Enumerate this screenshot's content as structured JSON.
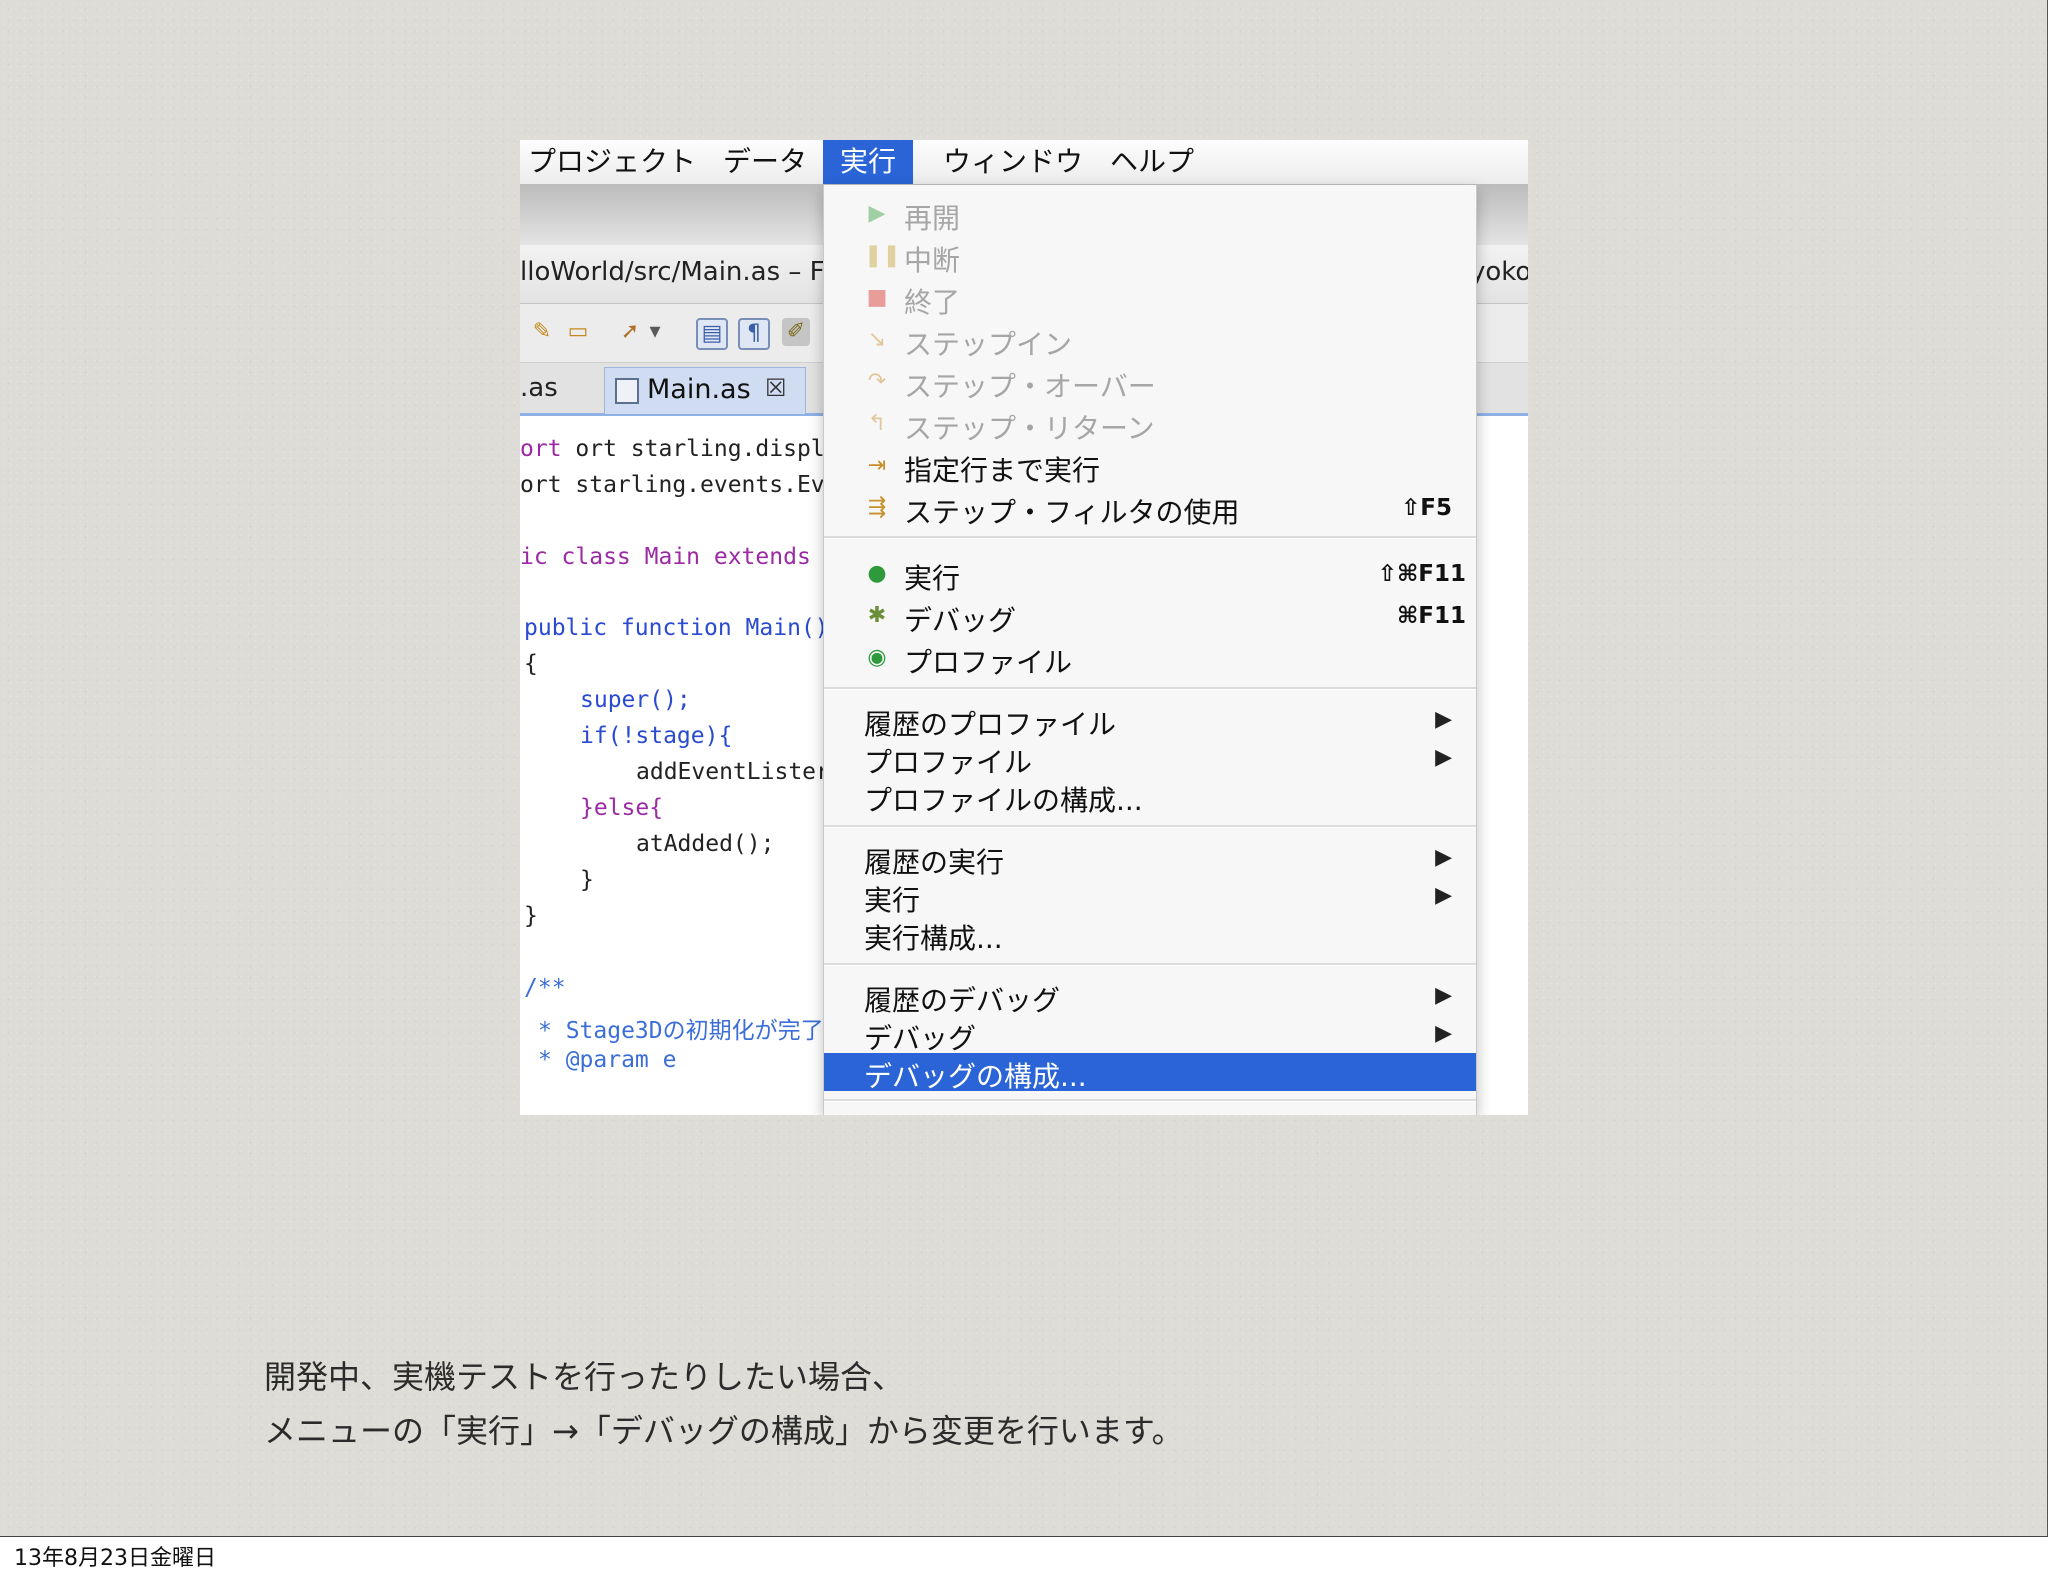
{
  "screenshot": {
    "menubar": [
      "プロジェクト",
      "データ",
      "実行",
      "ウィンドウ",
      "ヘルプ"
    ],
    "active_menu": "実行",
    "title_left": "lloWorld/src/Main.as – F",
    "title_right": "yoko",
    "tabs": {
      "left": ".as",
      "active": "Main.as",
      "close": "☒"
    },
    "code_lines": [
      "ort starling.display.Sp",
      "ort starling.events.Eve",
      "ic class Main extends",
      "public function Main()",
      "{",
      "super();",
      "if(!stage){",
      "addEventLister",
      "}else{",
      "atAdded();",
      "}",
      "}",
      "/**",
      "* Stage3Dの初期化が完了",
      "* @param e"
    ],
    "dropdown": {
      "debug_group": [
        {
          "label": "再開",
          "icon": "resume-icon",
          "disabled": true
        },
        {
          "label": "中断",
          "icon": "suspend-icon",
          "disabled": true
        },
        {
          "label": "終了",
          "icon": "terminate-icon",
          "disabled": true
        },
        {
          "label": "ステップイン",
          "icon": "step-into-icon",
          "disabled": true
        },
        {
          "label": "ステップ・オーバー",
          "icon": "step-over-icon",
          "disabled": true
        },
        {
          "label": "ステップ・リターン",
          "icon": "step-return-icon",
          "disabled": true
        },
        {
          "label": "指定行まで実行",
          "icon": "run-to-line-icon",
          "disabled": false
        },
        {
          "label": "ステップ・フィルタの使用",
          "icon": "step-filter-icon",
          "shortcut": "⇧F5",
          "disabled": false
        }
      ],
      "launch_group": [
        {
          "label": "実行",
          "icon": "run-icon",
          "shortcut": "⇧⌘F11"
        },
        {
          "label": "デバッグ",
          "icon": "debug-icon",
          "shortcut": "⌘F11"
        },
        {
          "label": "プロファイル",
          "icon": "profile-icon",
          "shortcut": ""
        }
      ],
      "profile_group": [
        {
          "label": "履歴のプロファイル",
          "submenu": true
        },
        {
          "label": "プロファイル",
          "submenu": true
        },
        {
          "label": "プロファイルの構成...",
          "submenu": false
        }
      ],
      "run_group": [
        {
          "label": "履歴の実行",
          "submenu": true
        },
        {
          "label": "実行",
          "submenu": true
        },
        {
          "label": "実行構成...",
          "submenu": false
        }
      ],
      "debug_config_group": [
        {
          "label": "履歴のデバッグ",
          "submenu": true
        },
        {
          "label": "デバッグ",
          "submenu": true
        },
        {
          "label": "デバッグの構成...",
          "submenu": false,
          "selected": true
        }
      ],
      "submenu_arrow": "▶"
    }
  },
  "caption": {
    "line1": "開発中、実機テストを行ったりしたい場合、",
    "line2": "メニューの「実行」→「デバッグの構成」から変更を行います。"
  },
  "footer": {
    "date": "13年8月23日金曜日"
  },
  "colors": {
    "highlight": "#2a64d6",
    "slide_bg": "#dedcd7"
  }
}
